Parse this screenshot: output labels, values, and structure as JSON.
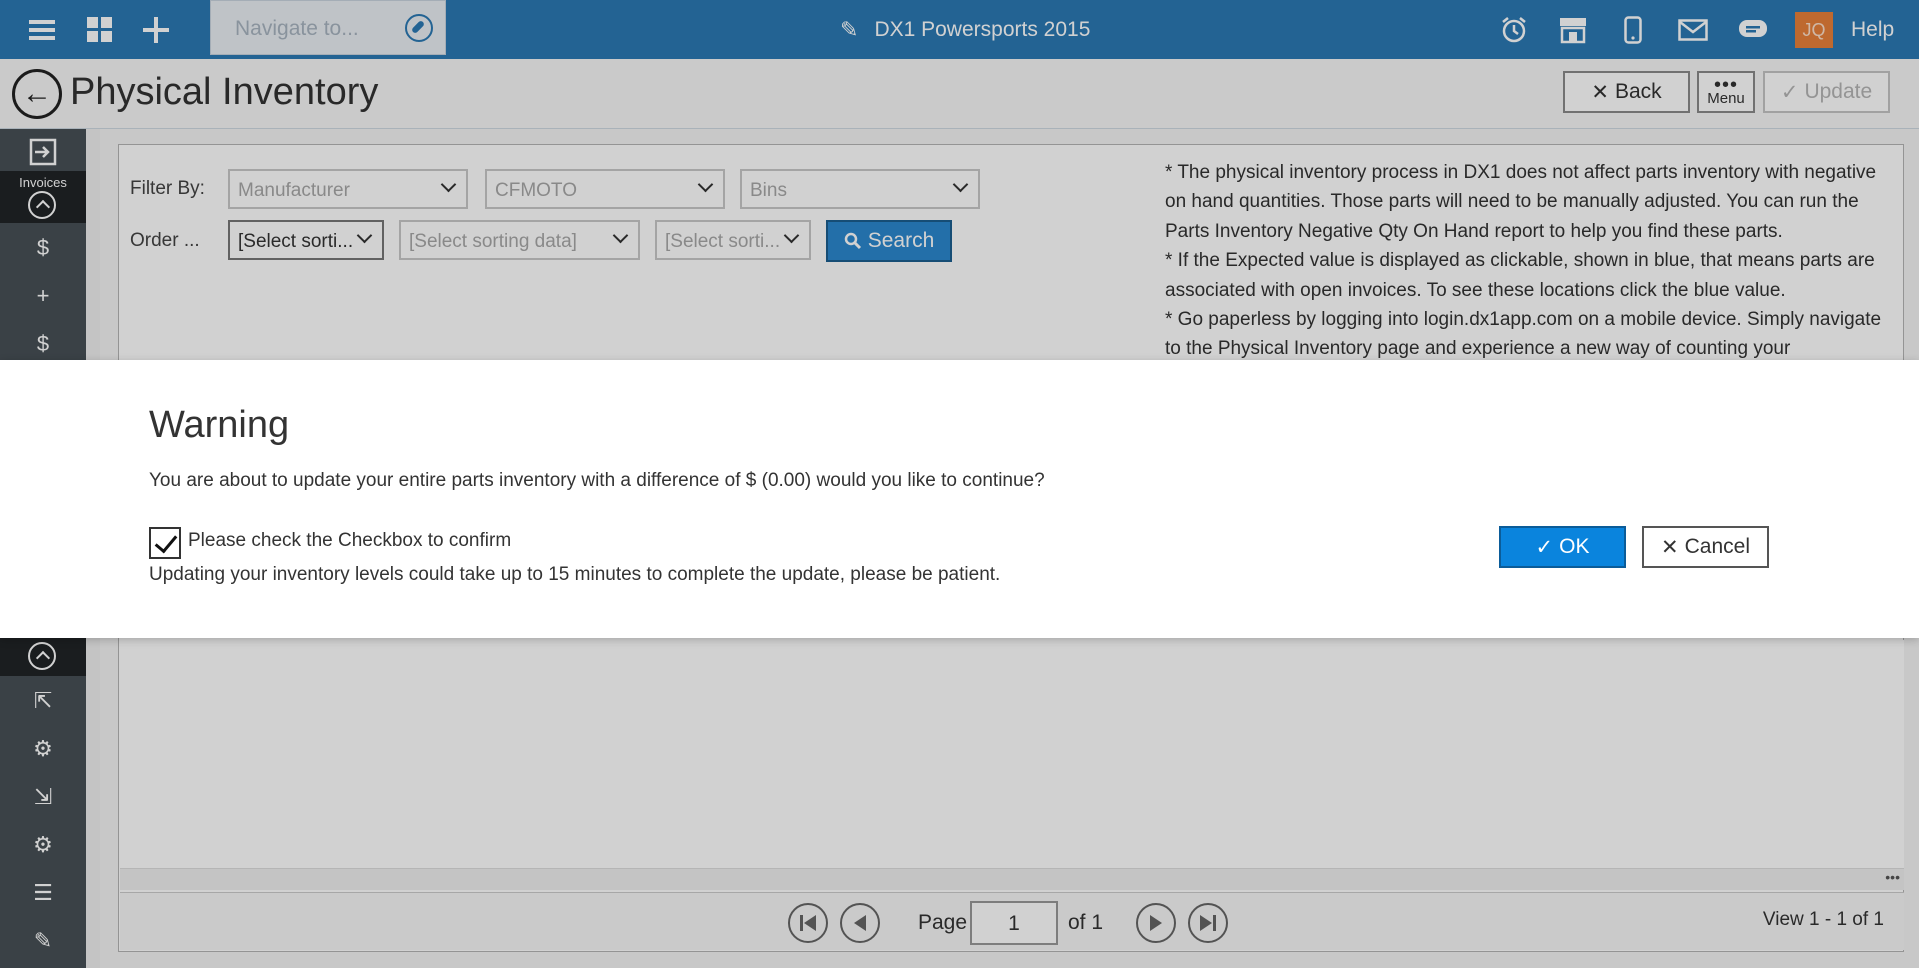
{
  "topbar": {
    "navigate_placeholder": "Navigate to...",
    "app_title": "DX1 Powersports 2015",
    "avatar_initials": "JQ",
    "help_label": "Help"
  },
  "header": {
    "title": "Physical Inventory",
    "back_label": "Back",
    "menu_label": "Menu",
    "update_label": "Update"
  },
  "sidebar": {
    "invoices_label": "Invoices"
  },
  "filters": {
    "filter_by_label": "Filter By:",
    "order_label": "Order ...",
    "filter_1": "Manufacturer",
    "filter_2": "CFMOTO",
    "filter_3": "Bins",
    "sort_1": "[Select sorti...",
    "sort_2": "[Select sorting data]",
    "sort_3": "[Select sorti...",
    "search_label": "Search"
  },
  "info": {
    "lines": [
      "* The physical inventory process in DX1 does not affect parts inventory with negative on hand quantities. Those parts will need to be manually adjusted. You can run the Parts Inventory Negative Qty On Hand report to help you find these parts.",
      "* If the Expected value is displayed as clickable, shown in blue, that means parts are associated with open invoices. To see these locations click the blue value.",
      "* Go paperless by logging into login.dx1app.com on a mobile device. Simply navigate to the Physical Inventory page and experience a new way of counting your"
    ]
  },
  "pager": {
    "page_label": "Page",
    "page_value": "1",
    "of_label": "of 1",
    "view_label": "View 1 - 1 of 1"
  },
  "modal": {
    "title": "Warning",
    "message": "You are about to update your entire parts inventory with a difference of $ (0.00) would you like to continue?",
    "checkbox_label": "Please check the Checkbox to confirm",
    "checkbox_checked": true,
    "note": "Updating your inventory levels could take up to 15 minutes to complete the update, please be patient.",
    "ok_label": "OK",
    "cancel_label": "Cancel"
  },
  "colors": {
    "topbar": "#2b79b4",
    "sidebar": "#475056",
    "accent_button": "#0a84dd",
    "avatar": "#e8813a"
  }
}
